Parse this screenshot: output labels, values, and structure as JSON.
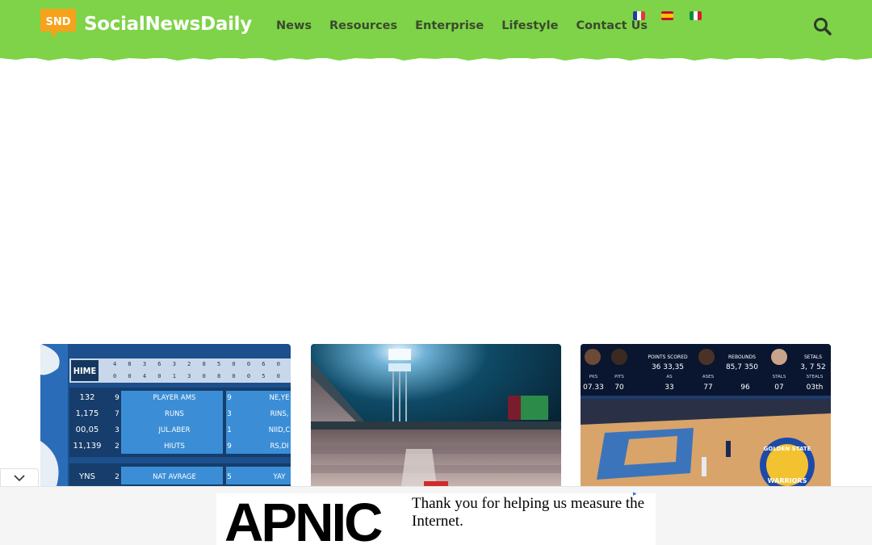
{
  "header": {
    "logo_mark": "SND",
    "logo_text": "SocialNewsDaily",
    "nav": [
      {
        "label": "News"
      },
      {
        "label": "Resources"
      },
      {
        "label": "Enterprise"
      },
      {
        "label": "Lifestyle"
      },
      {
        "label": "Contact Us"
      }
    ],
    "languages": [
      {
        "name": "french-flag",
        "colors": [
          "#1f3f9a",
          "#ffffff",
          "#e03a3e"
        ]
      },
      {
        "name": "spanish-flag",
        "colors": [
          "#c8102e",
          "#ffc400",
          "#c8102e"
        ]
      },
      {
        "name": "italian-flag",
        "colors": [
          "#0a8f3c",
          "#ffffff",
          "#d0202e"
        ]
      }
    ],
    "search_icon": "search-icon",
    "background": "#7ed348"
  },
  "cards": [
    {
      "name": "baseball-scoreboard",
      "rows": [
        {
          "num": "132",
          "mid": "9",
          "label": "PLAYER AMS",
          "right_num": "9",
          "right": "NE,YE"
        },
        {
          "num": "1,175",
          "mid": "7",
          "label": "RUNS",
          "right_num": "3",
          "right": "RINS,"
        },
        {
          "num": "00,05",
          "mid": "3",
          "label": "JUL.ABER",
          "right_num": "1",
          "right": "NIID,C"
        },
        {
          "num": "11,139",
          "mid": "2",
          "label": "HIUTS",
          "right_num": "9",
          "right": "RS,DI"
        },
        {
          "num": "YNS",
          "mid": "2",
          "label": "NAT AVRAGE",
          "right_num": "5",
          "right": "YAY"
        }
      ],
      "header_label": "HIME",
      "innings_top": "4 8 3 6 3 2 8 5 0 0 6 0 6 0",
      "innings_bottom": "0 0 4 0 1 3 0 8 0 0 5 0 0 3"
    },
    {
      "name": "stadium-photo"
    },
    {
      "name": "basketball-scoreboard",
      "stats": [
        {
          "label": "POINTS SCORED",
          "values": "36   33,35"
        },
        {
          "label": "REBOUNDS",
          "values": "85,7   350"
        },
        {
          "label": "SETALS",
          "values": "3, 7 52"
        }
      ],
      "lower": [
        {
          "label": "PKS",
          "value": "07.33"
        },
        {
          "label": "PITS",
          "value": "70"
        },
        {
          "label": "AS",
          "value": "33"
        },
        {
          "label": "ASES",
          "value": "77"
        },
        {
          "label": "",
          "value": "96"
        },
        {
          "label": "STALS",
          "value": "07"
        },
        {
          "label": "STEALS",
          "value": "03th"
        }
      ],
      "team_text": "GOLDEN STATE",
      "team_sub": "WARRIORS"
    }
  ],
  "ad": {
    "brand": "APNIC",
    "message": "Thank you for helping us measure the Internet.",
    "collapse_icon": "chevron-down-icon"
  }
}
